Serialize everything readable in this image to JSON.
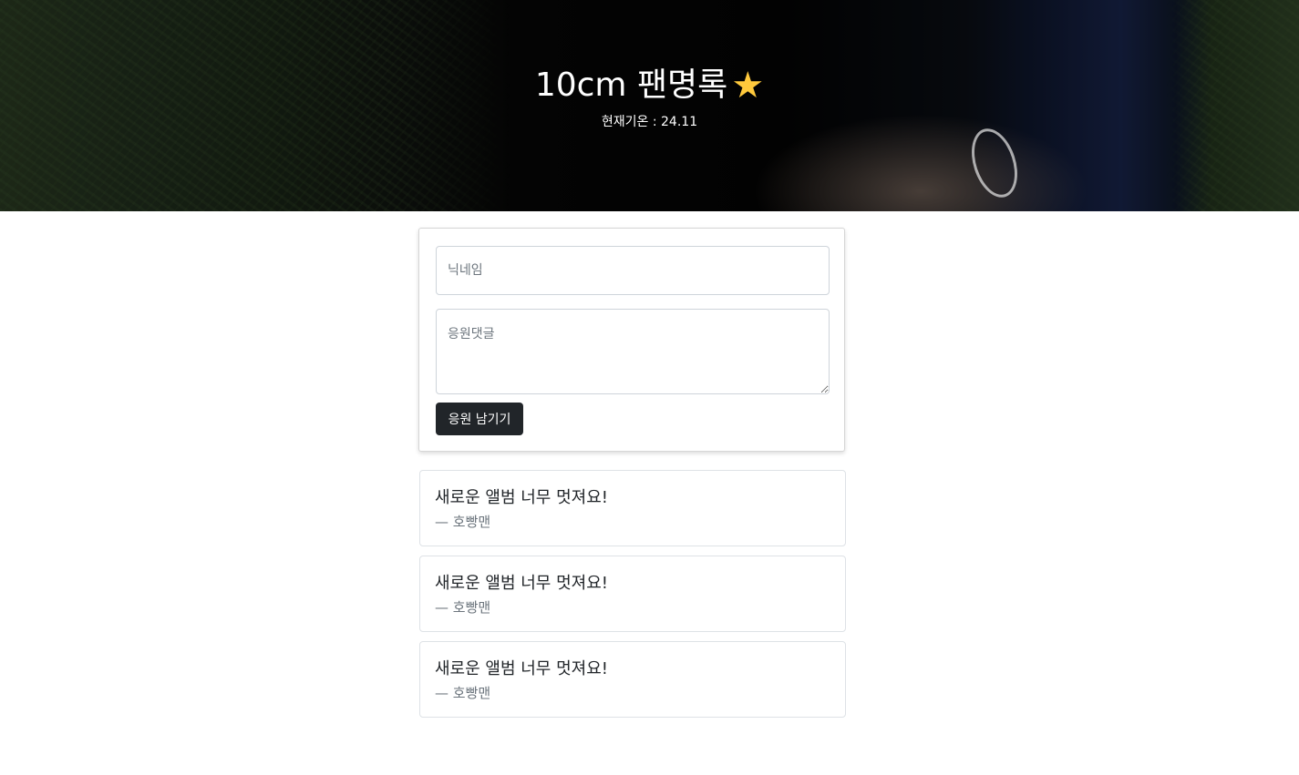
{
  "header": {
    "title": "10cm 팬명록",
    "star_icon": "star-icon",
    "star_color": "#ffc93c",
    "subtitle": "현재기온 : 24.11"
  },
  "form": {
    "nickname_placeholder": "닉네임",
    "comment_placeholder": "응원댓글",
    "submit_label": "응원 남기기",
    "button_color": "#212529"
  },
  "comments": [
    {
      "text": "새로운 앨범 너무 멋져요!",
      "author": "— 호빵맨"
    },
    {
      "text": "새로운 앨범 너무 멋져요!",
      "author": "— 호빵맨"
    },
    {
      "text": "새로운 앨범 너무 멋져요!",
      "author": "— 호빵맨"
    }
  ]
}
